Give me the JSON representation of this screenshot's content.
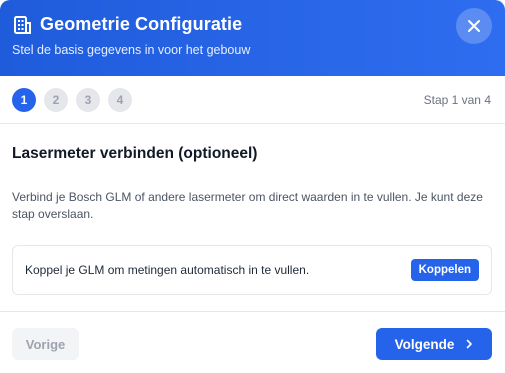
{
  "header": {
    "icon": "building-icon",
    "title": "Geometrie Configuratie",
    "subtitle": "Stel de basis gegevens in voor het gebouw",
    "close_icon": "close-icon"
  },
  "steps": {
    "items": [
      "1",
      "2",
      "3",
      "4"
    ],
    "active_index": 0,
    "counter": "Stap 1 van 4"
  },
  "content": {
    "title": "Lasermeter verbinden (optioneel)",
    "description": "Verbind je Bosch GLM of andere lasermeter om direct waarden in te vullen. Je kunt deze stap overslaan.",
    "card": {
      "text": "Koppel je GLM om metingen automatisch in te vullen.",
      "button_label": "Koppelen"
    }
  },
  "footer": {
    "prev_label": "Vorige",
    "next_label": "Volgende",
    "next_icon": "chevron-right-icon"
  },
  "colors": {
    "accent": "#2563eb",
    "header_start": "#1f5cdc",
    "header_end": "#2f6df0",
    "inactive_step": "#e5e7eb"
  }
}
